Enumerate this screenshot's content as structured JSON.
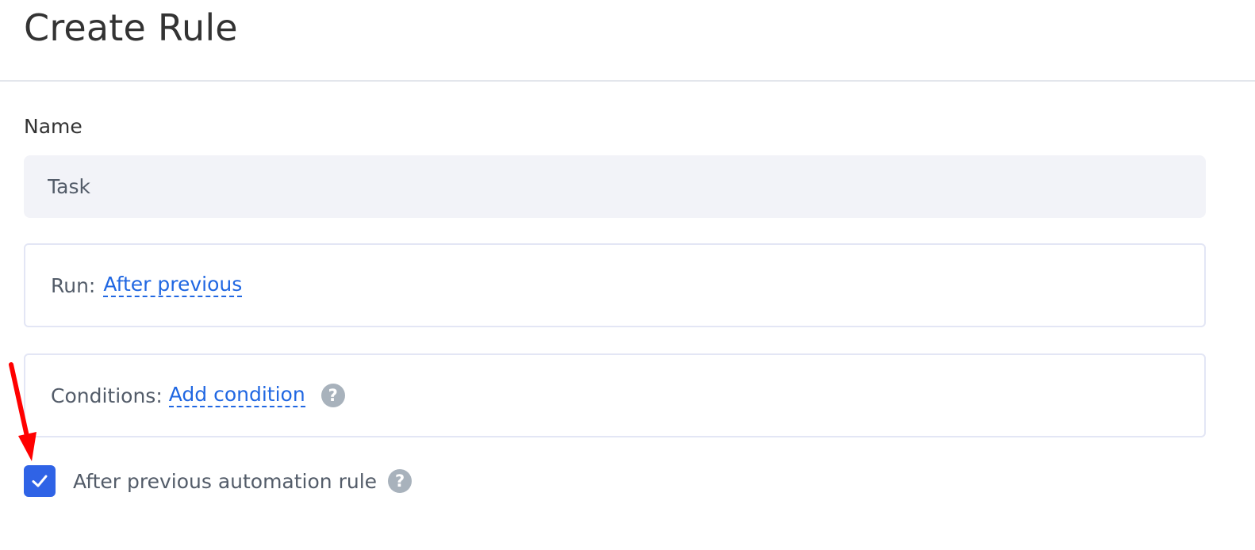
{
  "header": {
    "title": "Create Rule"
  },
  "form": {
    "name_label": "Name",
    "name_value": "Task",
    "run": {
      "label": "Run:",
      "value": "After previous"
    },
    "conditions": {
      "label": "Conditions:",
      "link": "Add condition",
      "help_glyph": "?"
    },
    "after_previous": {
      "checked": true,
      "label": "After previous automation rule",
      "help_glyph": "?"
    }
  },
  "annotation": {
    "arrow_color": "#ff0000"
  },
  "colors": {
    "accent": "#2f63e6",
    "link": "#2067e2",
    "input_bg": "#f2f3f8",
    "help_icon_bg": "#a8b2bc"
  },
  "icons": {
    "checkbox_check": "check-icon",
    "help": "help-icon",
    "annotation": "arrow-icon"
  }
}
